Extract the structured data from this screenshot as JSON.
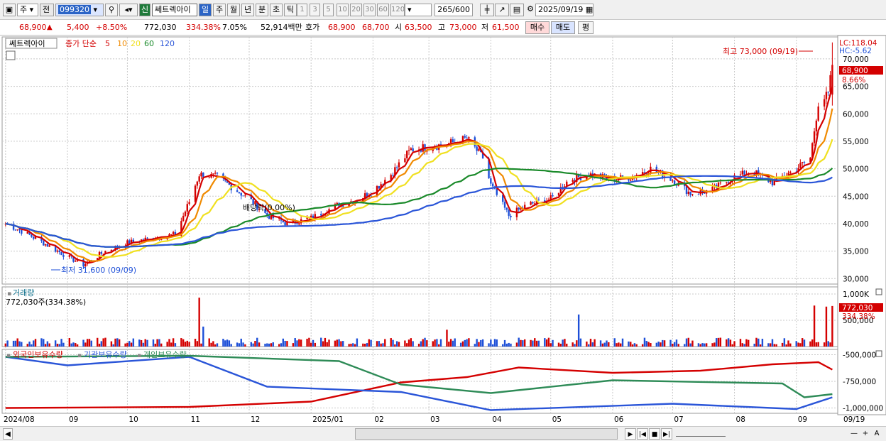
{
  "toolbar": {
    "type_label": "주",
    "market_label": "전",
    "code": "099320",
    "new_badge": "신",
    "stock_name": "쎄트렉아이",
    "period_tabs": [
      "일",
      "주",
      "월",
      "년",
      "분",
      "초",
      "틱"
    ],
    "interval_buttons": [
      "1",
      "3",
      "5",
      "10",
      "20",
      "30",
      "60",
      "120"
    ],
    "count_value": "265",
    "count_total": "/600",
    "date_value": "2025/09/19"
  },
  "price_bar": {
    "price": "68,900",
    "up_arrow": "▲",
    "change": "5,400",
    "change_pct": "+8.50%",
    "volume": "772,030",
    "volume_ratio": "334.38%",
    "turnover": "7.05%",
    "amount": "52,914백만",
    "quote_label": "호가",
    "ask": "68,900",
    "bid": "68,700",
    "open_label": "시",
    "open": "63,500",
    "high_label": "고",
    "high": "73,000",
    "low_label": "저",
    "low": "61,500",
    "buy_label": "매수",
    "sell_label": "매도",
    "eval_label": "평"
  },
  "legend": {
    "stock_name": "쎄트렉아이",
    "ma_label": "종가 단순",
    "ma_periods": [
      "5",
      "10",
      "20",
      "60",
      "120"
    ],
    "ma_colors": [
      "#d40000",
      "#f08a00",
      "#f0e020",
      "#1a8a2a",
      "#2a55d8"
    ]
  },
  "annotations": {
    "high": "최고 73,000 (09/19)",
    "low": "최저 31,600 (09/09)",
    "dividend": "배당락(0.00%)",
    "lc": "LC:118.04",
    "hc": "HC:-5.62",
    "last_price": "68,900",
    "last_pct": "8.66%",
    "vol_title": "거래량",
    "vol_value": "772,030주(334.38%)",
    "vol_last": "772,030",
    "vol_pct": "334.38%",
    "inv_labels": [
      "외국인보유수량",
      "기관보유수량",
      "개인보유수량"
    ]
  },
  "colors": {
    "up": "#d40000",
    "down": "#1d4fd8",
    "foreign": "#d40000",
    "institution": "#2a55d8",
    "individual": "#2e8b57"
  },
  "chart_data": [
    {
      "type": "candlestick",
      "title": "쎄트렉아이",
      "ylim": [
        29000,
        74000
      ],
      "y_ticks": [
        "30,000",
        "35,000",
        "40,000",
        "45,000",
        "50,000",
        "55,000",
        "60,000",
        "65,000",
        "70,000"
      ],
      "x_tick_labels": [
        "2024/08",
        "09",
        "10",
        "11",
        "12",
        "2025/01",
        "02",
        "03",
        "04",
        "05",
        "06",
        "07",
        "08",
        "09",
        "09/19"
      ],
      "x_tick_dates": [
        "2024-08-01",
        "2024-09-01",
        "2024-10-01",
        "2024-11-01",
        "2024-12-01",
        "2025-01-01",
        "2025-02-01",
        "2025-03-01",
        "2025-04-01",
        "2025-05-01",
        "2025-06-01",
        "2025-07-01",
        "2025-08-01",
        "2025-09-01",
        "2025-09-19"
      ],
      "close_series": [
        [
          "2024-08-01",
          40000
        ],
        [
          "2024-08-10",
          38500
        ],
        [
          "2024-08-20",
          36500
        ],
        [
          "2024-09-01",
          34000
        ],
        [
          "2024-09-09",
          32500
        ],
        [
          "2024-09-20",
          35000
        ],
        [
          "2024-10-01",
          36500
        ],
        [
          "2024-10-15",
          37500
        ],
        [
          "2024-10-25",
          38000
        ],
        [
          "2024-11-01",
          44000
        ],
        [
          "2024-11-06",
          49000
        ],
        [
          "2024-11-15",
          48500
        ],
        [
          "2024-11-25",
          46000
        ],
        [
          "2024-12-01",
          44500
        ],
        [
          "2024-12-10",
          41500
        ],
        [
          "2024-12-20",
          40000
        ],
        [
          "2025-01-01",
          41000
        ],
        [
          "2025-01-15",
          43500
        ],
        [
          "2025-01-25",
          44500
        ],
        [
          "2025-02-01",
          46000
        ],
        [
          "2025-02-10",
          49000
        ],
        [
          "2025-02-20",
          53500
        ],
        [
          "2025-03-01",
          54000
        ],
        [
          "2025-03-10",
          54500
        ],
        [
          "2025-03-20",
          55500
        ],
        [
          "2025-03-28",
          52000
        ],
        [
          "2025-04-01",
          47000
        ],
        [
          "2025-04-10",
          41500
        ],
        [
          "2025-04-20",
          43500
        ],
        [
          "2025-05-01",
          44500
        ],
        [
          "2025-05-10",
          48000
        ],
        [
          "2025-05-20",
          49000
        ],
        [
          "2025-06-01",
          48000
        ],
        [
          "2025-06-10",
          48500
        ],
        [
          "2025-06-20",
          50000
        ],
        [
          "2025-07-01",
          48000
        ],
        [
          "2025-07-10",
          45500
        ],
        [
          "2025-07-20",
          46000
        ],
        [
          "2025-08-01",
          48500
        ],
        [
          "2025-08-10",
          49500
        ],
        [
          "2025-08-20",
          47500
        ],
        [
          "2025-09-01",
          50000
        ],
        [
          "2025-09-08",
          52000
        ],
        [
          "2025-09-12",
          62000
        ],
        [
          "2025-09-17",
          63500
        ],
        [
          "2025-09-19",
          68900
        ]
      ],
      "last_candle": {
        "date": "2025-09-19",
        "open": 63500,
        "high": 73000,
        "low": 61500,
        "close": 68900
      }
    },
    {
      "type": "bar",
      "title": "거래량",
      "ylim": [
        0,
        1000000
      ],
      "y_ticks": [
        "1,000K",
        "500,000"
      ],
      "spikes": [
        [
          "2024-11-06",
          930000
        ],
        [
          "2024-11-08",
          380000
        ],
        [
          "2025-02-15",
          400000
        ],
        [
          "2025-03-10",
          320000
        ],
        [
          "2025-05-15",
          610000
        ],
        [
          "2025-09-10",
          780000
        ],
        [
          "2025-09-16",
          760000
        ],
        [
          "2025-09-19",
          772030
        ]
      ]
    },
    {
      "type": "line",
      "title": "외국인보유수량 / 기관보유수량 / 개인보유수량",
      "ylim": [
        -1050000,
        -450000
      ],
      "y_ticks": [
        "-500,000",
        "-750,000",
        "-1,000,000"
      ],
      "series": [
        {
          "name": "외국인보유수량",
          "values": [
            [
              "2024-08-01",
              -1000000
            ],
            [
              "2024-11-01",
              -990000
            ],
            [
              "2025-01-01",
              -940000
            ],
            [
              "2025-02-15",
              -760000
            ],
            [
              "2025-03-20",
              -710000
            ],
            [
              "2025-04-15",
              -620000
            ],
            [
              "2025-06-01",
              -670000
            ],
            [
              "2025-07-15",
              -650000
            ],
            [
              "2025-08-20",
              -590000
            ],
            [
              "2025-09-12",
              -570000
            ],
            [
              "2025-09-19",
              -640000
            ]
          ]
        },
        {
          "name": "기관보유수량",
          "values": [
            [
              "2024-08-01",
              -520000
            ],
            [
              "2024-09-01",
              -600000
            ],
            [
              "2024-11-01",
              -520000
            ],
            [
              "2024-12-10",
              -800000
            ],
            [
              "2025-02-15",
              -850000
            ],
            [
              "2025-04-01",
              -1020000
            ],
            [
              "2025-07-01",
              -960000
            ],
            [
              "2025-09-01",
              -1010000
            ],
            [
              "2025-09-19",
              -900000
            ]
          ]
        },
        {
          "name": "개인보유수량",
          "values": [
            [
              "2024-08-01",
              -520000
            ],
            [
              "2024-11-01",
              -510000
            ],
            [
              "2025-01-15",
              -560000
            ],
            [
              "2025-02-15",
              -780000
            ],
            [
              "2025-04-01",
              -860000
            ],
            [
              "2025-06-01",
              -740000
            ],
            [
              "2025-08-25",
              -770000
            ],
            [
              "2025-09-05",
              -900000
            ],
            [
              "2025-09-19",
              -870000
            ]
          ]
        }
      ]
    }
  ],
  "scrollbar": {
    "nav_buttons": [
      "▶",
      "|◀",
      "■",
      "▶|"
    ],
    "zoom_buttons": [
      "—",
      "+",
      "A"
    ]
  }
}
